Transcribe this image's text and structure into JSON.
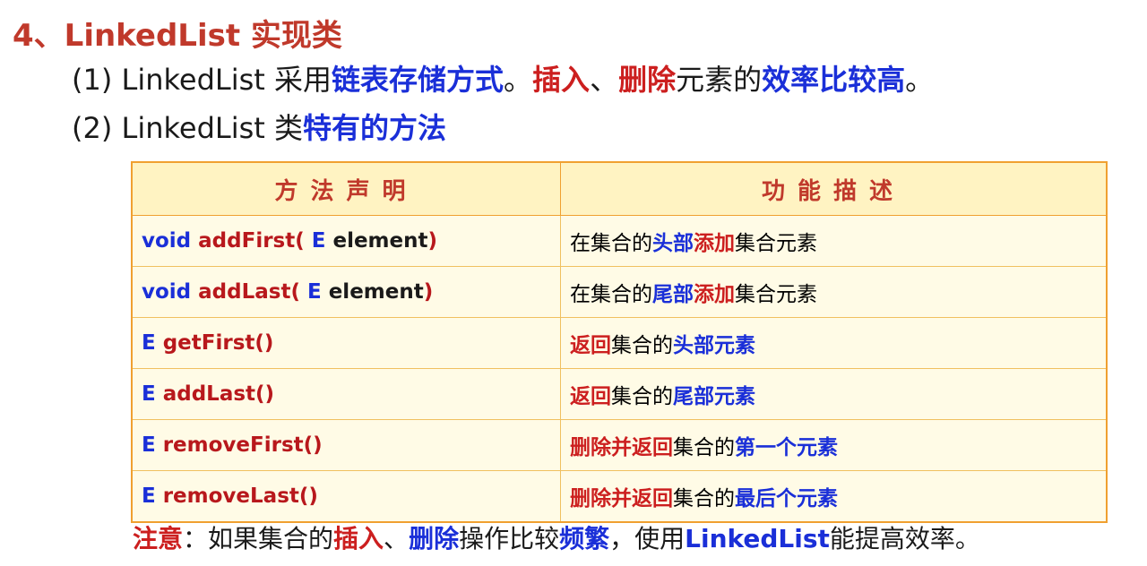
{
  "title": "4、LinkedList 实现类",
  "point1": {
    "prefix": "(1) LinkedList 采用",
    "storage": "链表存储方式",
    "sep1": "。",
    "insert": "插入",
    "sep2": "、",
    "delete": "删除",
    "mid": "元素的",
    "efficiency": "效率比较高",
    "end": "。"
  },
  "point2": {
    "prefix": "(2) LinkedList 类",
    "methods": "特有的方法"
  },
  "table": {
    "header_decl": "方法声明",
    "header_desc": "功能描述",
    "rows": [
      {
        "decl": [
          "void ",
          "addFirst( ",
          "E",
          " element",
          ")"
        ],
        "desc": [
          "在集合的",
          "头部",
          "添加",
          "集合元素"
        ]
      },
      {
        "decl": [
          "void ",
          "addLast( ",
          "E",
          " element",
          ")"
        ],
        "desc": [
          "在集合的",
          "尾部",
          "添加",
          "集合元素"
        ]
      },
      {
        "decl": [
          "E ",
          "getFirst()",
          "",
          "",
          ""
        ],
        "desc": [
          "返回",
          "集合的",
          "头部元素",
          ""
        ]
      },
      {
        "decl": [
          "E ",
          "addLast()",
          "",
          "",
          ""
        ],
        "desc": [
          "返回",
          "集合的",
          "尾部元素",
          ""
        ]
      },
      {
        "decl": [
          "E ",
          "removeFirst()",
          "",
          "",
          ""
        ],
        "desc": [
          "删除并返回",
          "集合的",
          "第一个元素",
          ""
        ]
      },
      {
        "decl": [
          "E ",
          "removeLast()",
          "",
          "",
          ""
        ],
        "desc": [
          "删除并返回",
          "集合的",
          "最后个元素",
          ""
        ]
      }
    ]
  },
  "note": {
    "label": "注意",
    "t1": "：如果集合的",
    "insert": "插入",
    "sep": "、",
    "delete": "删除",
    "t2": "操作比较",
    "freq": "频繁",
    "t3": "，使用",
    "ll": "LinkedList",
    "t4": "能提高效率。"
  }
}
